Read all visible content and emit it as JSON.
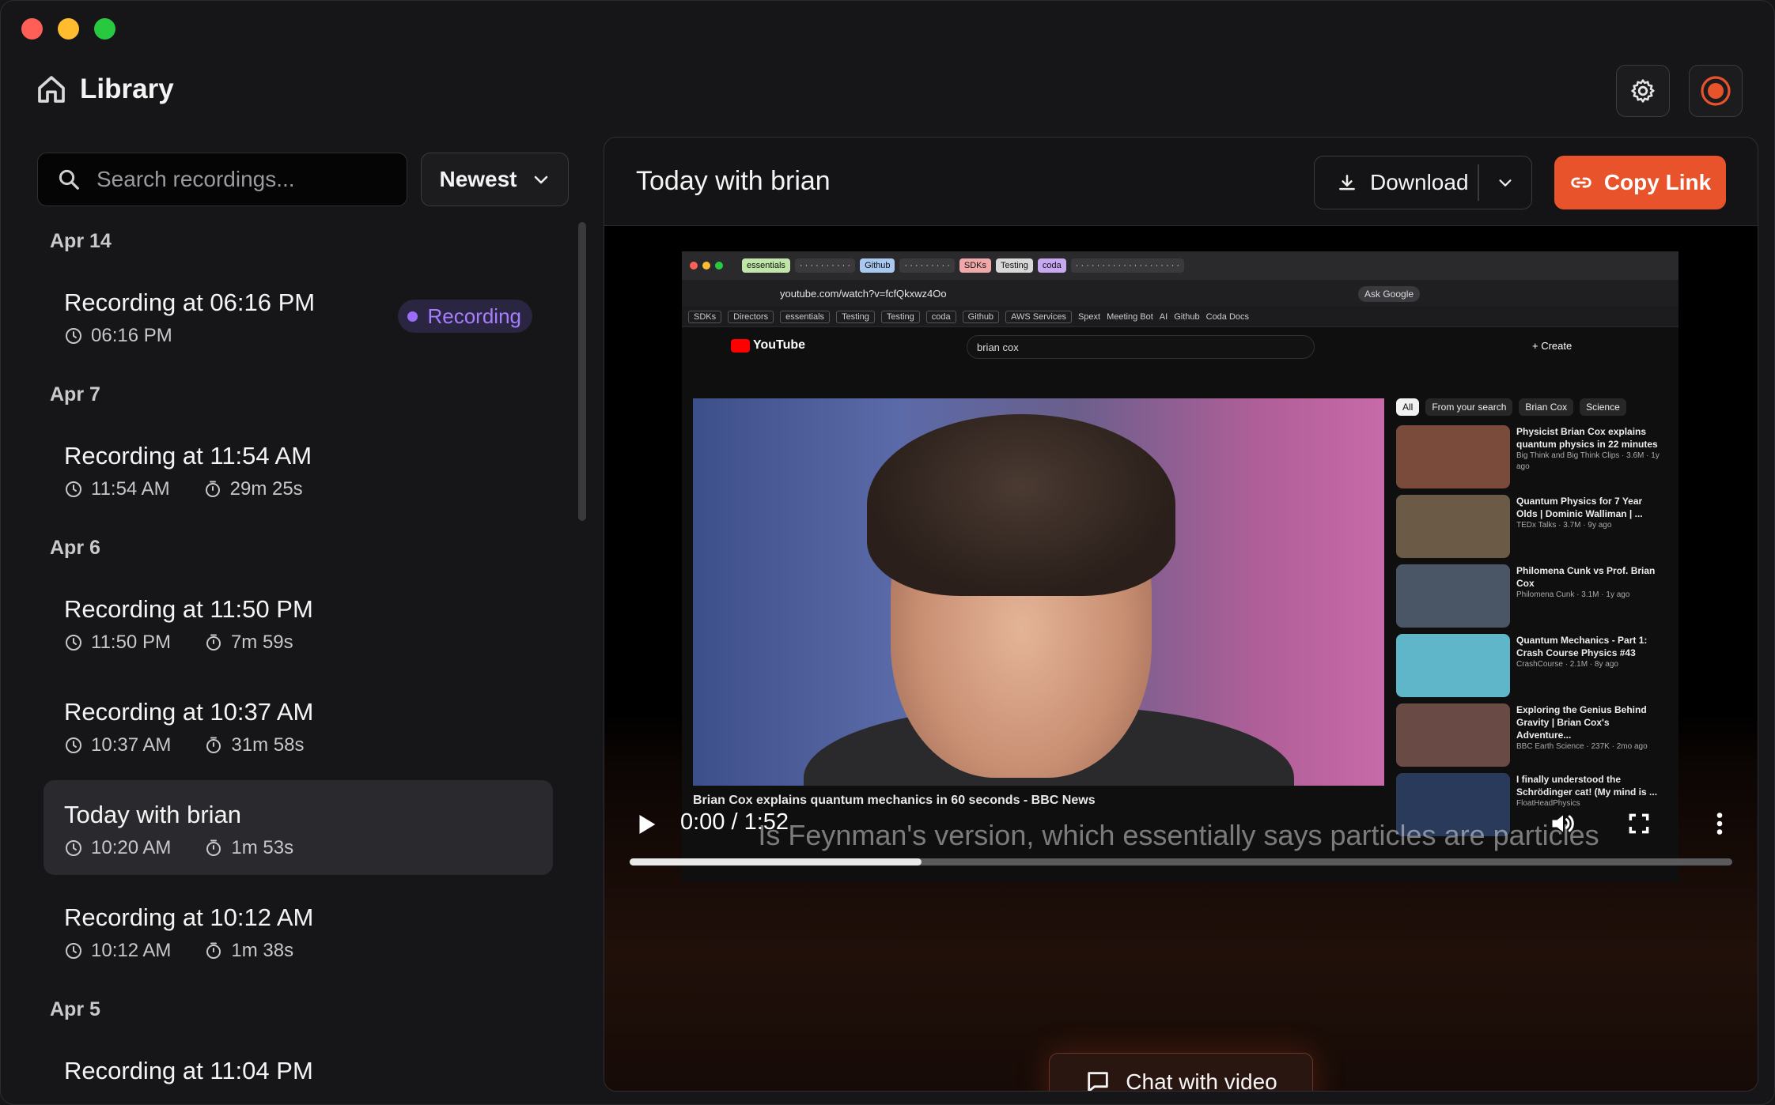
{
  "window": {
    "traffic_lights": [
      "close",
      "minimize",
      "maximize"
    ]
  },
  "header": {
    "title": "Library",
    "icons": {
      "home": "home-icon",
      "settings": "gear-icon",
      "record": "record-icon"
    }
  },
  "sidebar": {
    "search_placeholder": "Search recordings...",
    "sort_label": "Newest",
    "groups": [
      {
        "date": "Apr 14",
        "items": [
          {
            "title": "Recording at 06:16 PM",
            "time": "06:16 PM",
            "duration": "",
            "badge": "Recording"
          }
        ]
      },
      {
        "date": "Apr 7",
        "items": [
          {
            "title": "Recording at 11:54 AM",
            "time": "11:54 AM",
            "duration": "29m 25s"
          }
        ]
      },
      {
        "date": "Apr 6",
        "items": [
          {
            "title": "Recording at 11:50 PM",
            "time": "11:50 PM",
            "duration": "7m 59s"
          },
          {
            "title": "Recording at 10:37 AM",
            "time": "10:37 AM",
            "duration": "31m 58s"
          },
          {
            "title": "Today with brian",
            "time": "10:20 AM",
            "duration": "1m 53s",
            "selected": true
          },
          {
            "title": "Recording at 10:12 AM",
            "time": "10:12 AM",
            "duration": "1m 38s"
          }
        ]
      },
      {
        "date": "Apr 5",
        "items": [
          {
            "title": "Recording at 11:04 PM"
          }
        ]
      }
    ]
  },
  "main": {
    "title": "Today with brian",
    "download_label": "Download",
    "copy_link_label": "Copy Link",
    "accent": "#e8532b",
    "video": {
      "time": "0:00 / 1:52",
      "progress": 0.265,
      "caption": "Is Feynman's version, which essentially says particles are particles",
      "screen": {
        "url": "youtube.com/watch?v=fcfQkxwz4Oo",
        "ask_label": "Ask Google",
        "yt_search": "brian  cox",
        "create": "+ Create",
        "chips": [
          "All",
          "From your search",
          "Brian Cox",
          "Science"
        ],
        "video_title": "Brian Cox explains quantum mechanics in 60 seconds - BBC News",
        "bookmarks": [
          "SDKs",
          "Directors",
          "essentials",
          "Testing",
          "Testing",
          "coda",
          "Github",
          "AWS Services",
          "Spext",
          "Meeting Bot",
          "AI",
          "Github",
          "Coda Docs"
        ],
        "suggestions": [
          {
            "title": "Physicist Brian Cox explains quantum physics in 22 minutes",
            "sub": "Big Think and Big Think Clips · 3.6M · 1y ago",
            "color": "#7a4a3a"
          },
          {
            "title": "Quantum Physics for 7 Year Olds | Dominic Walliman | ...",
            "sub": "TEDx Talks · 3.7M · 9y ago",
            "color": "#6b5a45"
          },
          {
            "title": "Philomena Cunk vs Prof. Brian Cox",
            "sub": "Philomena Cunk · 3.1M · 1y ago",
            "color": "#4a5566"
          },
          {
            "title": "Quantum Mechanics - Part 1: Crash Course Physics #43",
            "sub": "CrashCourse · 2.1M · 8y ago",
            "color": "#5fb6c8"
          },
          {
            "title": "Exploring the Genius Behind Gravity | Brian Cox's Adventure...",
            "sub": "BBC Earth Science · 237K · 2mo ago",
            "color": "#6a4a44"
          },
          {
            "title": "I finally understood the Schrödinger cat! (My mind is ...",
            "sub": "FloatHeadPhysics",
            "color": "#2a3a5a"
          }
        ]
      }
    },
    "chat_label": "Chat with video"
  }
}
